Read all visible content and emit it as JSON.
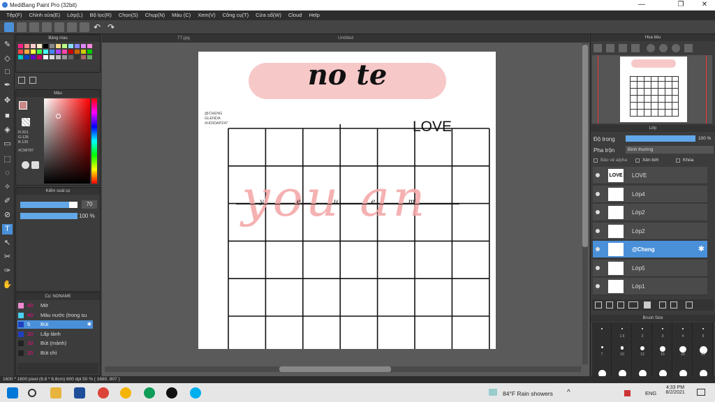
{
  "window": {
    "title": "MediBang Paint Pro (32bit)"
  },
  "menu": [
    "Tệp(F)",
    "Chỉnh sửa(E)",
    "Lớp(L)",
    "Bộ lọc(R)",
    "Chọn(S)",
    "Chụp(N)",
    "Màu (C)",
    "Xem(V)",
    "Công cụ(T)",
    "Cửa sổ(W)",
    "Cloud",
    "Help"
  ],
  "tabs": {
    "file1": "77.jpg",
    "file2": "Untitled"
  },
  "palette": {
    "title": "Bảng màu",
    "colors": [
      "#f28",
      "#f88",
      "#fcc",
      "#fec",
      "#000",
      "#888",
      "#fd8",
      "#bf8",
      "#8df",
      "#88f",
      "#d8f",
      "#f8d",
      "#f44",
      "#fa4",
      "#ff4",
      "#4f4",
      "#4ff",
      "#48f",
      "#a4f",
      "#f4a",
      "#c00",
      "#c60",
      "#cc0",
      "#0c0",
      "#0cc",
      "#04c",
      "#60c",
      "#c06",
      "#fff",
      "#ddd",
      "#bbb",
      "#999",
      "#666",
      "#333",
      "#a66",
      "#6a6"
    ]
  },
  "color_panel": {
    "title": "Màu",
    "r": "R:201",
    "g": "G:135",
    "b": "B:135",
    "hex": "#C98787",
    "fg": "#c98787",
    "bg": "#ffffff"
  },
  "brush_control": {
    "title": "Kiểm soát cọ",
    "size": "70",
    "opacity": "100 %",
    "size_fill": 0.85
  },
  "brush_list": {
    "title": "Cọ: NONAME",
    "items": [
      {
        "num": "40",
        "label": "Mờ",
        "color": "#f08ad0"
      },
      {
        "num": "40",
        "label": "Màu nước (trong su",
        "color": "#4ad0f0"
      },
      {
        "num": "5",
        "label": "Bút",
        "color": "#2040c0",
        "selected": true
      },
      {
        "num": "20",
        "label": "Lấp lánh",
        "color": "#2040c0"
      },
      {
        "num": "10",
        "label": "Bút (mảnh)",
        "color": "#222"
      },
      {
        "num": "20",
        "label": "Bút chì",
        "color": "#222"
      }
    ]
  },
  "canvas": {
    "title": "no te",
    "love": "LOVE",
    "handles": [
      "@CHENG",
      "GLENDA",
      "#HOIDAP247"
    ],
    "script": "you an",
    "sub": "y e u e m"
  },
  "navigator": {
    "title": "Hoa tiêu"
  },
  "layers": {
    "title": "Lớp",
    "opacity_label": "Độ trong",
    "opacity_value": "100 %",
    "blend_label": "Pha trộn",
    "blend_value": "Bình thường",
    "protect_alpha": "Bảo vệ alpha",
    "clipping": "Xén bớt",
    "lock": "Khóa",
    "items": [
      {
        "name": "LOVE",
        "thumb_text": "LOVE"
      },
      {
        "name": "Lớp4"
      },
      {
        "name": "Lớp2"
      },
      {
        "name": "Lớp2"
      },
      {
        "name": "@Cheng",
        "selected": true
      },
      {
        "name": "Lớp5"
      },
      {
        "name": "Lớp1"
      }
    ]
  },
  "brush_size": {
    "title": "Brush Size",
    "labels": [
      "1.5",
      "2",
      "3",
      "4",
      "5",
      "7",
      "10",
      "12",
      "15",
      "20",
      "25"
    ]
  },
  "status": {
    "text": "1600 * 1600 pixel  (6.8 * 6.8cm)  600 dpi  50 %  ( 1680, 807 )"
  },
  "taskbar": {
    "weather": "84°F  Rain showers",
    "lang": "ENG",
    "time": "4:33 PM",
    "date": "8/2/2021"
  }
}
